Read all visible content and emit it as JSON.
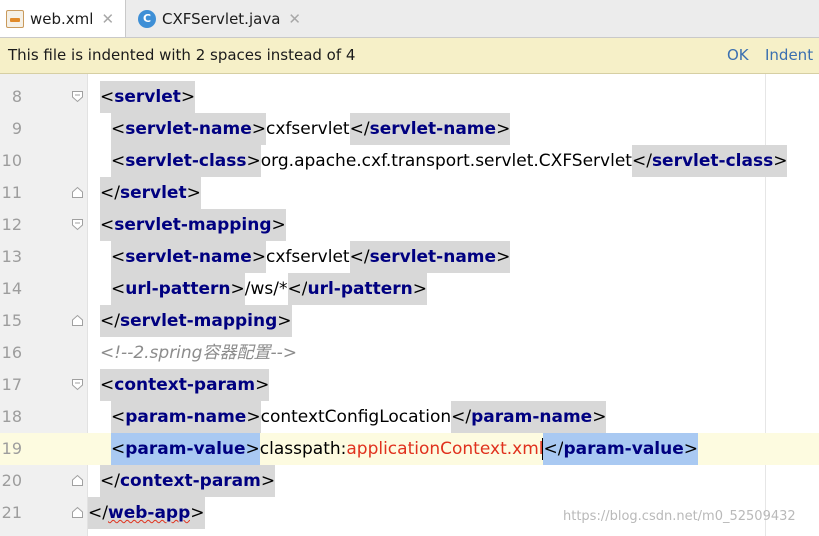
{
  "tabs": [
    {
      "label": "web.xml",
      "icon": "xml-file-icon",
      "active": true
    },
    {
      "label": "CXFServlet.java",
      "icon": "java-class-icon",
      "active": false
    }
  ],
  "banner": {
    "message": "This file is indented with 2 spaces instead of 4",
    "ok_label": "OK",
    "indent_label": "Indent"
  },
  "editor": {
    "current_line": "19",
    "lines": [
      {
        "num": "8",
        "tokens": [
          "<",
          "servlet",
          ">"
        ]
      },
      {
        "num": "9",
        "tokens": [
          "<",
          "servlet-name",
          ">",
          "cxfservlet",
          "</",
          "servlet-name",
          ">"
        ]
      },
      {
        "num": "10",
        "tokens": [
          "<",
          "servlet-class",
          ">",
          "org.apache.cxf.transport.servlet.CXFServlet",
          "</",
          "servlet-class",
          ">"
        ]
      },
      {
        "num": "11",
        "tokens": [
          "</",
          "servlet",
          ">"
        ]
      },
      {
        "num": "12",
        "tokens": [
          "<",
          "servlet-mapping",
          ">"
        ]
      },
      {
        "num": "13",
        "tokens": [
          "<",
          "servlet-name",
          ">",
          "cxfservlet",
          "</",
          "servlet-name",
          ">"
        ]
      },
      {
        "num": "14",
        "tokens": [
          "<",
          "url-pattern",
          ">",
          "/ws/*",
          "</",
          "url-pattern",
          ">"
        ]
      },
      {
        "num": "15",
        "tokens": [
          "</",
          "servlet-mapping",
          ">"
        ]
      },
      {
        "num": "16",
        "tokens": [
          "<!--2.spring容器配置-->"
        ]
      },
      {
        "num": "17",
        "tokens": [
          "<",
          "context-param",
          ">"
        ]
      },
      {
        "num": "18",
        "tokens": [
          "<",
          "param-name",
          ">",
          "contextConfigLocation",
          "</",
          "param-name",
          ">"
        ]
      },
      {
        "num": "19",
        "tokens": [
          "<",
          "param-value",
          ">",
          "classpath:",
          "applicationContext.xml",
          "</",
          "param-value",
          ">"
        ]
      },
      {
        "num": "20",
        "tokens": [
          "</",
          "context-param",
          ">"
        ]
      },
      {
        "num": "21",
        "tokens": [
          "</",
          "web-app",
          ">"
        ]
      }
    ]
  },
  "watermark": "https://blog.csdn.net/m0_52509432",
  "colors": {
    "tag": "#000080",
    "comment": "#8c8c8c",
    "error_text": "#e0311d",
    "selection": "#a9c9f2",
    "banner_bg": "#f6f0c8",
    "current_line_bg": "#fdfbe0"
  }
}
